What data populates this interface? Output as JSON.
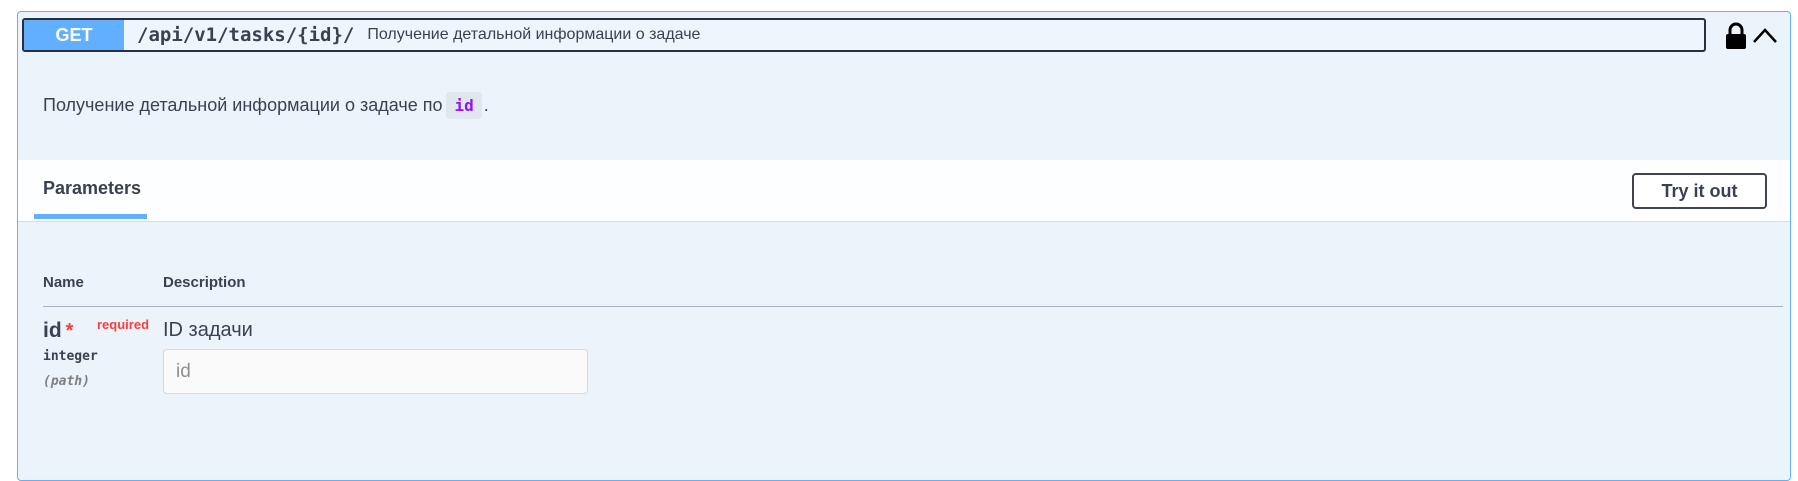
{
  "operation": {
    "method": "GET",
    "path": "/api/v1/tasks/{id}/",
    "summary": "Получение детальной информации о задаче",
    "description_text": "Получение детальной информации о задаче по",
    "description_code": "id",
    "description_end": "."
  },
  "parameters_section": {
    "tab_label": "Parameters",
    "try_button_label": "Try it out",
    "columns": {
      "name": "Name",
      "description": "Description"
    }
  },
  "parameter": {
    "name": "id",
    "required_star": "*",
    "required_label": "required",
    "type": "integer",
    "in": "(path)",
    "description": "ID задачи",
    "input_value": "",
    "input_placeholder": "id"
  },
  "icons": {
    "lock": "lock-icon",
    "collapse": "chevron-up-icon"
  },
  "colors": {
    "get_method": "#61affe",
    "block_background": "#ebf3fb",
    "required": "#f93e3e",
    "code": "#9012fe"
  }
}
